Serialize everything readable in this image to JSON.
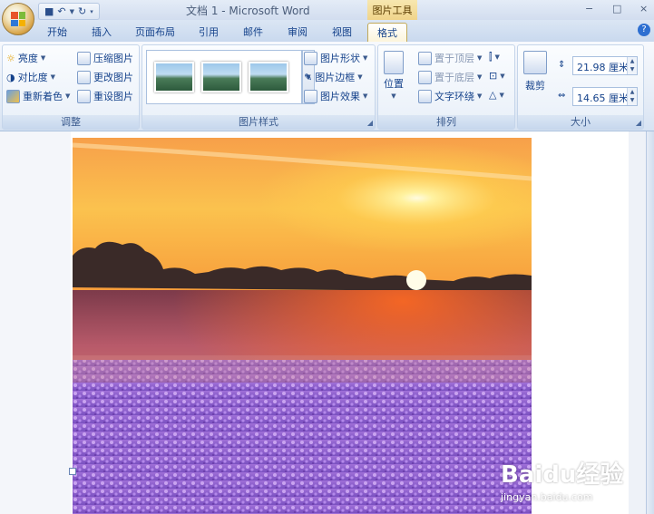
{
  "window": {
    "title": "文档 1 - Microsoft Word",
    "context_tab": "图片工具",
    "controls": [
      "−",
      "□",
      "×"
    ]
  },
  "tabs": [
    "开始",
    "插入",
    "页面布局",
    "引用",
    "邮件",
    "审阅",
    "视图",
    "格式"
  ],
  "active_tab": "格式",
  "groups": {
    "adjust": {
      "label": "调整",
      "buttons": [
        "亮度",
        "对比度",
        "重新着色",
        "压缩图片",
        "更改图片",
        "重设图片"
      ]
    },
    "styles": {
      "label": "图片样式",
      "buttons": [
        "图片形状",
        "图片边框",
        "图片效果"
      ]
    },
    "arrange": {
      "label": "排列",
      "position": "位置",
      "buttons": [
        "置于顶层",
        "置于底层",
        "文字环绕"
      ]
    },
    "size": {
      "label": "大小",
      "crop": "裁剪",
      "height": "21.98 厘米",
      "width": "14.65 厘米"
    }
  },
  "watermark": {
    "brand": "Baidu经验",
    "url": "jingyan.baidu.com"
  },
  "colors": {
    "ribbon_bg": "#e3ebf6",
    "active_tab_border": "#c0a95a",
    "context_tab": "#f0d48a",
    "text_blue": "#15428b"
  }
}
